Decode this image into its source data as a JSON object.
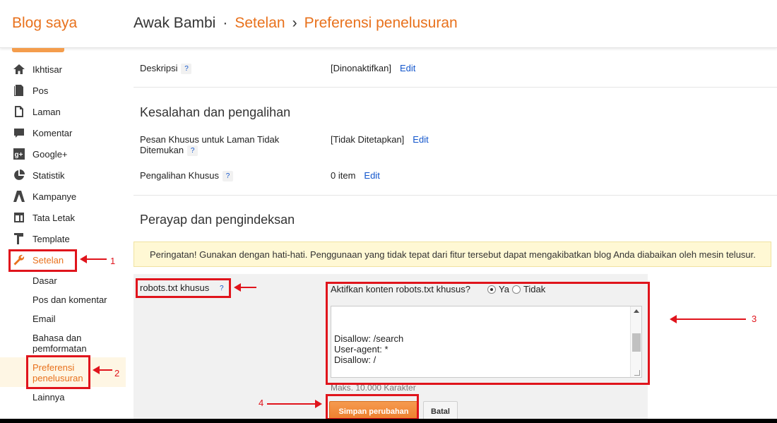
{
  "header": {
    "brand": "Blog saya",
    "blog_name": "Awak Bambi",
    "sep1": "·",
    "crumb_settings": "Setelan",
    "sep2": "›",
    "crumb_current": "Preferensi penelusuran"
  },
  "sidebar": {
    "items": [
      {
        "label": "Ikhtisar",
        "icon": "home-icon"
      },
      {
        "label": "Pos",
        "icon": "posts-icon"
      },
      {
        "label": "Laman",
        "icon": "pages-icon"
      },
      {
        "label": "Komentar",
        "icon": "comment-icon"
      },
      {
        "label": "Google+",
        "icon": "google-plus-icon"
      },
      {
        "label": "Statistik",
        "icon": "stats-icon"
      },
      {
        "label": "Kampanye",
        "icon": "campaign-icon"
      },
      {
        "label": "Tata Letak",
        "icon": "layout-icon"
      },
      {
        "label": "Template",
        "icon": "template-icon"
      },
      {
        "label": "Setelan",
        "icon": "wrench-icon"
      }
    ],
    "sub_items": [
      {
        "label": "Dasar"
      },
      {
        "label": "Pos dan komentar"
      },
      {
        "label": "Email"
      },
      {
        "label": "Bahasa dan\npemformatan"
      },
      {
        "label": "Preferensi\npenelusuran"
      },
      {
        "label": "Lainnya"
      }
    ]
  },
  "main": {
    "deskripsi_label": "Deskripsi",
    "deskripsi_value": "[Dinonaktifkan]",
    "edit_label": "Edit",
    "help_label": "?",
    "section_errors": "Kesalahan dan pengalihan",
    "pesan_label": "Pesan Khusus untuk Laman Tidak\nDitemukan",
    "pesan_value": "[Tidak Ditetapkan]",
    "pengalihan_label": "Pengalihan Khusus",
    "pengalihan_value": "0 item",
    "section_crawl": "Perayap dan pengindeksan",
    "warning": "Peringatan! Gunakan dengan hati-hati. Penggunaan yang tidak tepat dari fitur tersebut dapat mengakibatkan blog Anda diabaikan oleh mesin telusur.",
    "robots_label": "robots.txt khusus",
    "question": "Aktifkan konten robots.txt khusus?",
    "radio_yes": "Ya",
    "radio_no": "Tidak",
    "robots_content": "\nDisallow: /search\nUser-agent: *\nDisallow: /\n\nSitemap: http://awakbambi.blogspot.co.id/feeds/posts/default?\norderby=UPDATED",
    "max_chars": "Maks. 10.000 Karakter",
    "save_label": "Simpan perubahan",
    "cancel_label": "Batal"
  },
  "annotations": {
    "n1": "1",
    "n2": "2",
    "n3": "3",
    "n4": "4"
  },
  "colors": {
    "accent": "#e8711c",
    "annotation": "#e0141c",
    "link": "#1155cc",
    "warning_bg": "#fff8d4"
  }
}
